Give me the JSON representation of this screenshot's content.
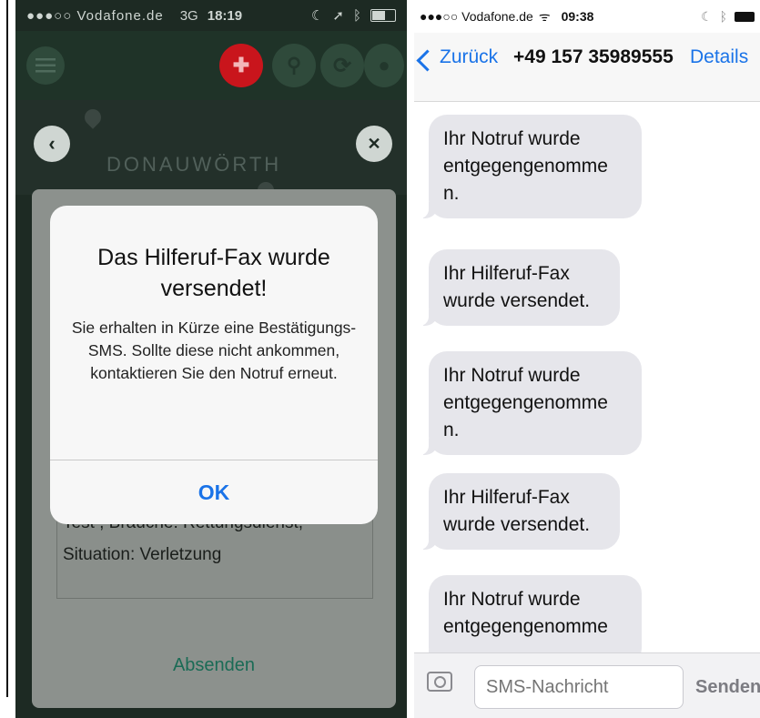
{
  "left": {
    "status": {
      "carrier": "●●●○○ Vodafone.de",
      "network": "3G",
      "time": "18:19"
    },
    "map_town": "DONAUWÖRTH",
    "nav": {
      "back_symbol": "‹",
      "close_symbol": "✕"
    },
    "form": {
      "message_lines": [
        "Test , Brauche: Rettungsdienst,",
        "Situation: Verletzung"
      ],
      "send_label": "Absenden"
    },
    "dialog": {
      "title": "Das Hilferuf-Fax wurde versendet!",
      "message": "Sie erhalten in Kürze eine Bestätigungs-SMS. Sollte diese nicht ankommen, kontaktieren Sie den Notruf erneut.",
      "ok_label": "OK"
    },
    "colors": {
      "accent_red": "#c9151c",
      "accent_green": "#1a6b55",
      "ok_blue": "#1a73e8"
    }
  },
  "right": {
    "status": {
      "carrier": "●●●○○ Vodafone.de",
      "wifi": "ᯤ",
      "time": "09:38"
    },
    "nav": {
      "back_label": "Zurück",
      "contact": "+49 157 35989555",
      "details_label": "Details"
    },
    "messages": [
      {
        "text": "Ihr Notruf wurde entgegengenomme n."
      },
      {
        "text": "Ihr Hilferuf-Fax wurde versendet."
      },
      {
        "text": "Ihr Notruf wurde entgegengenomme n."
      },
      {
        "text": "Ihr Hilferuf-Fax wurde versendet."
      },
      {
        "text": "Ihr Notruf wurde entgegengenomme"
      }
    ],
    "composer": {
      "placeholder": "SMS-Nachricht",
      "send_label": "Senden"
    },
    "colors": {
      "link_blue": "#1a73e8",
      "bubble_gray": "#e6e6eb"
    }
  }
}
